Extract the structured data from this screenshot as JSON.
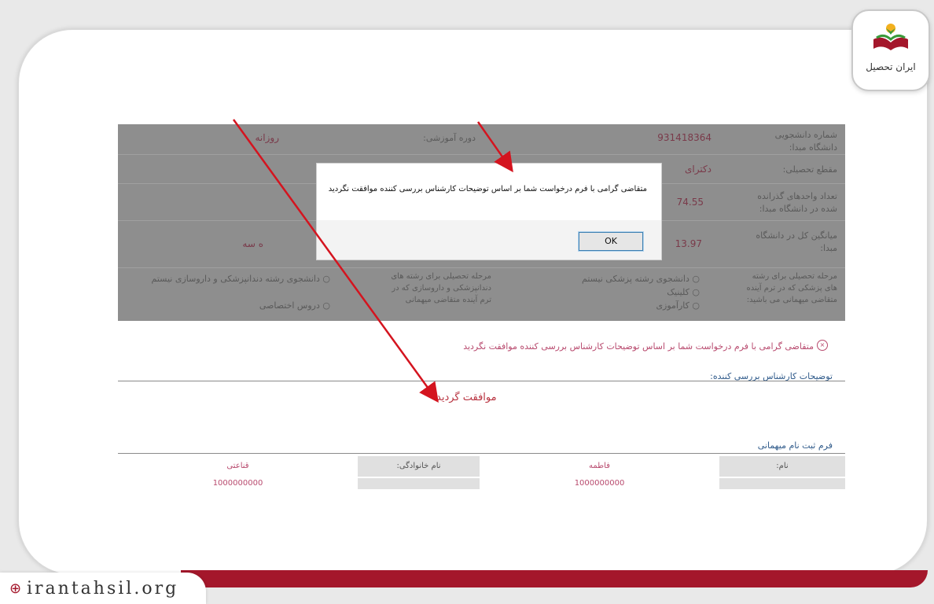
{
  "brand": {
    "logo_text": "ایران تحصیل",
    "site_url": "irantahsil.org",
    "accent_color": "#a4172b"
  },
  "form": {
    "rows": [
      {
        "label": "شماره دانشجویی دانشگاه مبدا:",
        "value": "931418364",
        "label2": "دوره آموزشی:",
        "value2": "روزانه"
      },
      {
        "label": "مقطع تحصیلی:",
        "value": "دکترای",
        "label2": "",
        "value2": ""
      },
      {
        "label": "تعداد واحدهای گذرانده شده در دانشگاه مبدا:",
        "value": "74.55",
        "label2": "",
        "value2": ""
      },
      {
        "label": "میانگین کل در دانشگاه مبدا:",
        "value": "13.97",
        "label2": "",
        "value2": "ه سه"
      }
    ],
    "stage_label": "مرحله تحصیلی برای رشته های پزشکی که در ترم آینده متقاضی میهمانی می باشید:",
    "stage_options": [
      "دانشجوی رشته پزشکی نیستم",
      "کلینیک",
      "کارآموزی"
    ],
    "stage_label_2": "مرحله تحصیلی برای رشته های دندانپزشکی و داروسازی که در ترم آینده متقاضی میهمانی",
    "stage_options_2": [
      "دانشجوی رشته دندانپزشکی و داروسازی نیستم",
      "دروس اختصاصی"
    ]
  },
  "dialog": {
    "message": "متقاضی گرامی با فرم درخواست شما بر اساس توضیحات کارشناس بررسی کننده موافقت نگردید",
    "ok_label": "OK"
  },
  "status": {
    "notice": "متقاضی گرامی با فرم درخواست شما بر اساس توضیحات کارشناس بررسی کننده موافقت نگردید",
    "reviewer_label": "توضیحات کارشناس بررسی کننده:",
    "reviewer_comment": "موافقت گردید",
    "guest_form_label": "فرم ثبت نام میهمانی"
  },
  "guest_table": {
    "name_label": "نام:",
    "name_value": "فاطمه",
    "family_label": "نام خانوادگی:",
    "family_value": "قناعتی",
    "row2_col1": "1000000000",
    "row2_col3": "1000000000"
  }
}
